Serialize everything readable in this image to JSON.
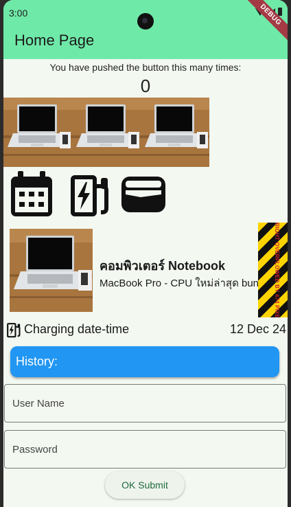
{
  "status_bar": {
    "time": "3:00"
  },
  "debug_banner": "DEBUG",
  "app_bar": {
    "title": "Home Page",
    "color": "#6fe9a8"
  },
  "counter": {
    "label": "You have pushed the button this many times:",
    "value": "0"
  },
  "gallery": {
    "images": [
      "laptop-photo",
      "laptop-photo",
      "laptop-photo"
    ]
  },
  "icons": [
    "calendar-icon",
    "ev-charger-icon",
    "wallet-icon"
  ],
  "product": {
    "title": "คอมพิวเตอร์ Notebook",
    "subtitle": "MacBook Pro - CPU ใหม่ล่าสุด bundle",
    "overflow_text": "RIGHT OVERFLOWED BY 474 PIXELS"
  },
  "charging": {
    "label": "Charging date-time",
    "date": "12 Dec 24"
  },
  "history": {
    "label": "History:",
    "color": "#2196f3"
  },
  "form": {
    "username_placeholder": "User Name",
    "password_placeholder": "Password",
    "submit_label": "OK Submit"
  }
}
